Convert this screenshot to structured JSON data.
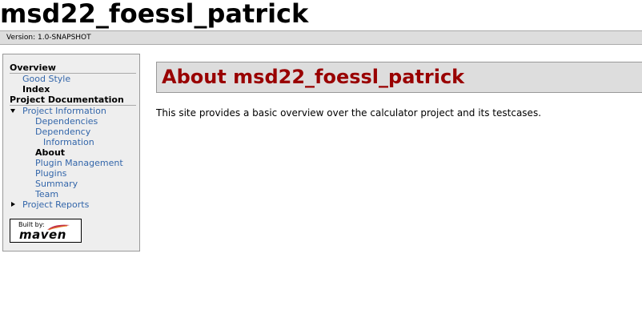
{
  "banner": {
    "title": "msd22_foessl_patrick"
  },
  "breadcrumbs": {
    "version": "Version: 1.0-SNAPSHOT"
  },
  "nav": {
    "overview_heading": "Overview",
    "overview_items": [
      {
        "label": "Good Style"
      },
      {
        "label": "Index"
      }
    ],
    "project_docs_heading": "Project Documentation",
    "project_info": {
      "label": "Project Information"
    },
    "project_info_items": [
      {
        "label": "Dependencies"
      },
      {
        "label": "Dependency"
      },
      {
        "label": "Information"
      },
      {
        "label": "About"
      },
      {
        "label": "Plugin Management"
      },
      {
        "label": "Plugins"
      },
      {
        "label": "Summary"
      },
      {
        "label": "Team"
      }
    ],
    "project_reports": {
      "label": "Project Reports"
    }
  },
  "powered_by": {
    "built_by": "Built by:",
    "maven": "maven"
  },
  "content": {
    "heading": "About msd22_foessl_patrick",
    "description": "This site provides a basic overview over the calculator project and its testcases."
  },
  "colors": {
    "link": "#3366aa",
    "heading": "#990000",
    "panel": "#eeeeee",
    "bar": "#dddddd"
  }
}
